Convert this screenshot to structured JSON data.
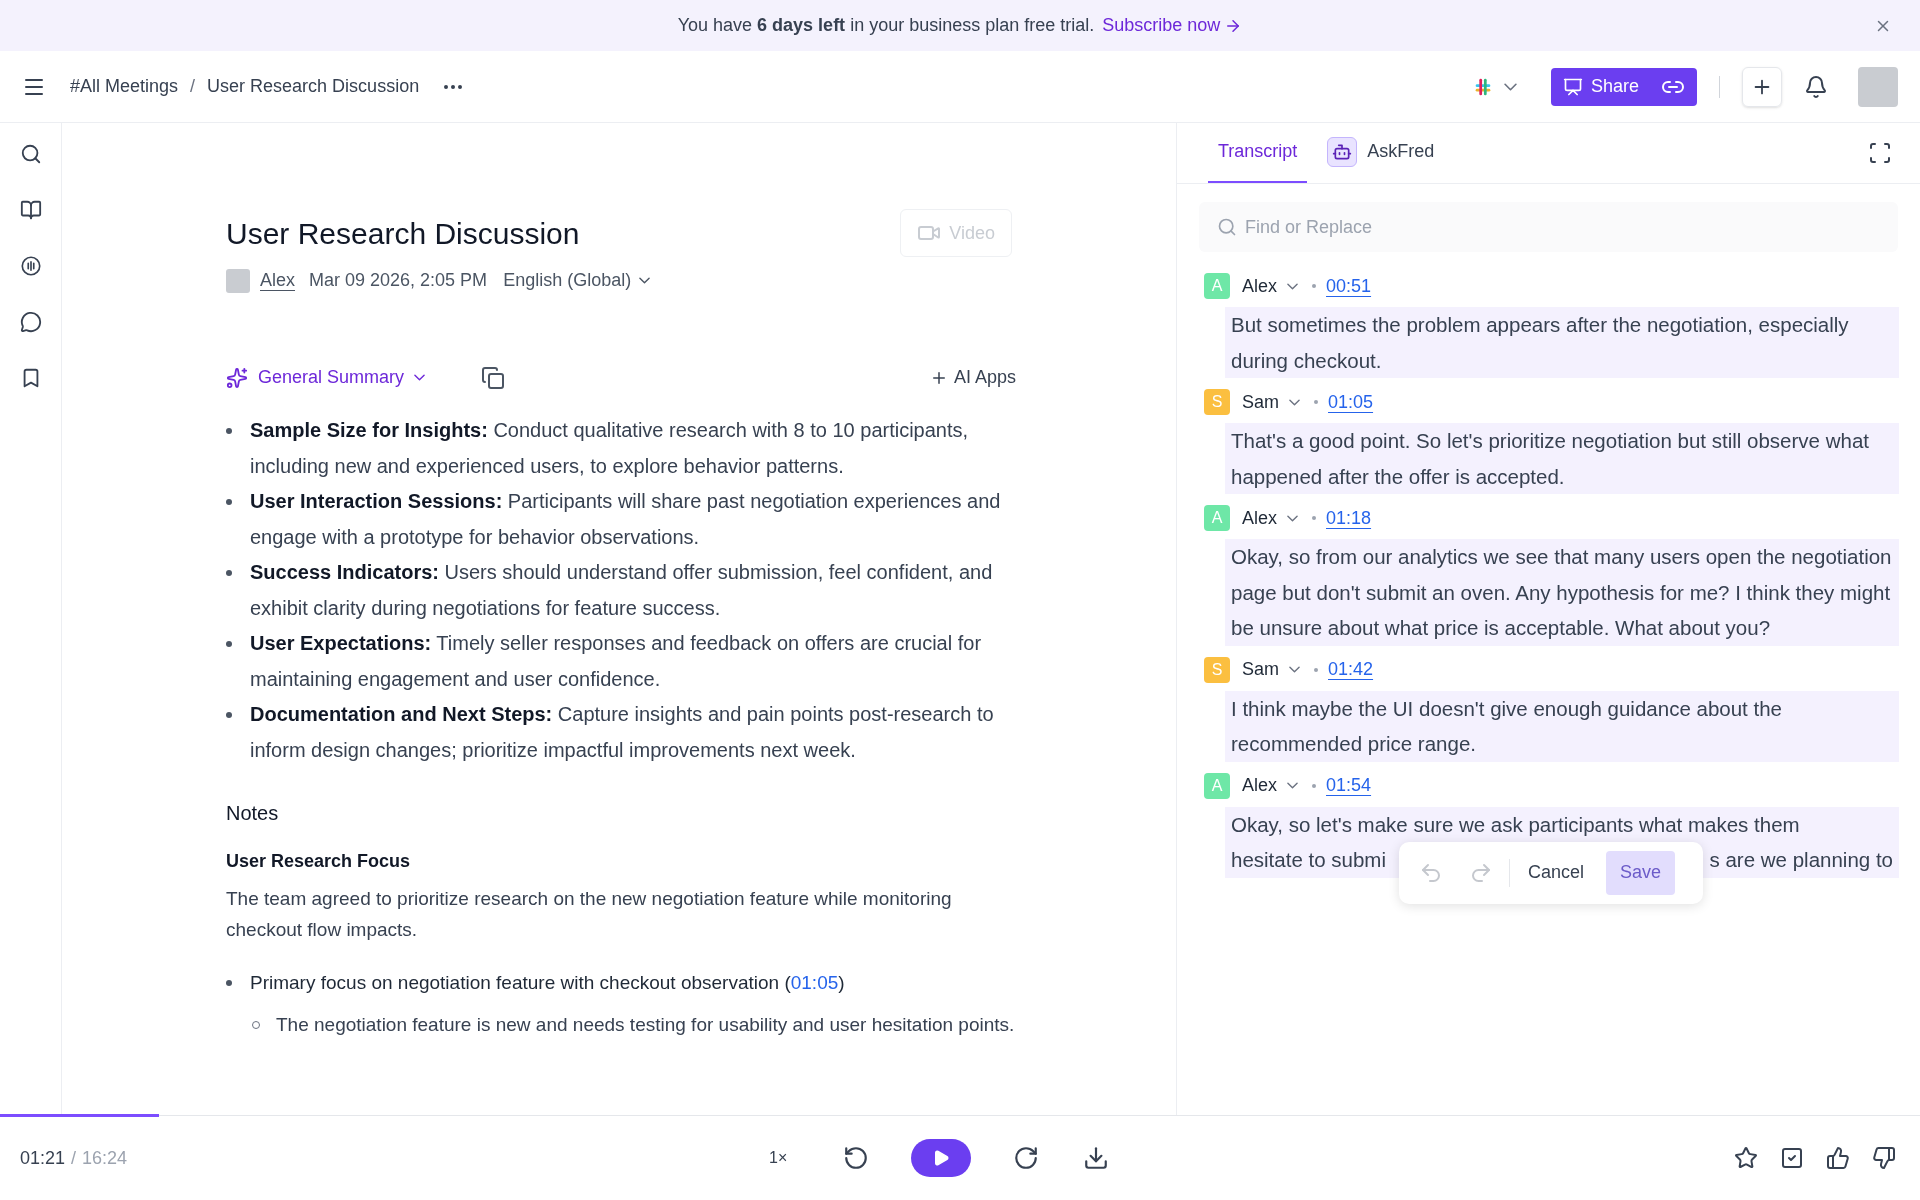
{
  "banner": {
    "text": "You have **6 days left** in your business plan free trial.",
    "link": "Subscribe now"
  },
  "header": {
    "breadcrumbs": [
      "#All Meetings",
      "User Research Discussion"
    ],
    "separator": "/",
    "share_label": "Share"
  },
  "sidebar": {
    "items": [
      {
        "kind": "search"
      },
      {
        "kind": "book"
      },
      {
        "kind": "audio"
      },
      {
        "kind": "chat"
      },
      {
        "kind": "bookmark"
      }
    ]
  },
  "meeting": {
    "title": "User Research Discussion",
    "video_label": "Video",
    "video_disabled": true,
    "author": "Alex",
    "datetime": "Mar 09 2026, 2:05 PM",
    "language": "English (Global)",
    "summary_label": "General Summary",
    "ai_apps": "AI Apps",
    "summary": [
      "**Sample Size for Insights:** Conduct qualitative research with 8 to 10 participants, including new and experienced users, to explore behavior patterns.",
      "**User Interaction Sessions:** Participants will share past negotiation experiences and engage with a prototype for behavior observations.",
      "**Success Indicators:** Users should understand offer submission, feel confident, and exhibit clarity during negotiations for feature success.",
      "**User Expectations:** Timely seller responses and feedback on offers are crucial for maintaining engagement and user confidence.",
      "**Documentation and Next Steps:** Capture insights and pain points post-research to inform design changes; prioritize impactful improvements next week."
    ],
    "notes_heading": "Notes",
    "section_heading": "User Research Focus",
    "section_text": "The team agreed to prioritize research on the new negotiation feature while monitoring checkout flow impacts.",
    "points": [
      {
        "text": "Primary focus on negotiation feature with checkout observation (",
        "timestamp": "01:05",
        "after": ")",
        "children": [
          {
            "text": "The negotiation feature is new and needs testing for usability and user hesitation points."
          }
        ]
      }
    ]
  },
  "transcript_panel": {
    "tabs": [
      {
        "label": "Transcript",
        "selected": true,
        "kind": "plain"
      },
      {
        "label": "AskFred",
        "selected": false,
        "kind": "bot"
      }
    ],
    "search": {
      "placeholder": "Find or Replace"
    },
    "entries": [
      {
        "speaker": "Alex",
        "initial": "A",
        "color": "#6ee7a7",
        "time": "00:51",
        "lines": [
          "But sometimes the problem appears after the negotiation, especially during checkout."
        ]
      },
      {
        "speaker": "Sam",
        "initial": "S",
        "color": "#fbbf40",
        "time": "01:05",
        "lines": [
          "That's a good point. So let's prioritize negotiation but still observe what happened after the offer is accepted."
        ]
      },
      {
        "speaker": "Alex",
        "initial": "A",
        "color": "#6ee7a7",
        "time": "01:18",
        "lines": [
          "Okay, so from our analytics we see that many users open the negotiation page but don't submit an oven. Any hypothesis for me? I think they might be unsure about what price is acceptable. What about you?"
        ]
      },
      {
        "speaker": "Sam",
        "initial": "S",
        "color": "#fbbf40",
        "time": "01:42",
        "lines": [
          "I think maybe the UI doesn't give enough guidance about the recommended price range."
        ]
      },
      {
        "speaker": "Alex",
        "initial": "A",
        "color": "#6ee7a7",
        "time": "01:54",
        "lines": [
          "Okay, so let's make sure we ask participants what makes them",
          "hesitate to submi",
          "s are we planning to"
        ]
      }
    ],
    "edit_popup": {
      "cancel": "Cancel",
      "save": "Save",
      "save_disabled": true
    }
  },
  "player": {
    "level": 0.083,
    "current": "01:21",
    "separator": "/",
    "duration": "16:24",
    "speed": "1×"
  }
}
